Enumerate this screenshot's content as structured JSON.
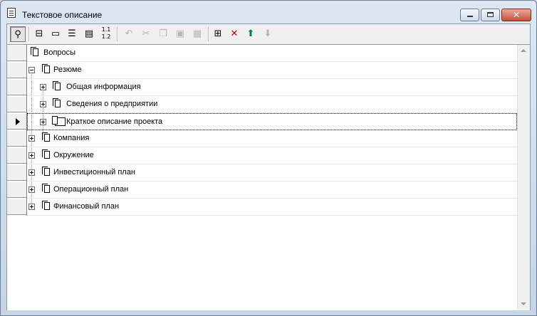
{
  "window": {
    "title": "Текстовое описание"
  },
  "toolbar": {
    "buttons": [
      {
        "name": "search-tool-icon",
        "glyph": "🔍"
      },
      {
        "name": "tree-structure-icon",
        "glyph": "⊞"
      },
      {
        "name": "comment-icon",
        "glyph": "💬"
      },
      {
        "name": "list-view-icon",
        "glyph": "≣"
      },
      {
        "name": "highlight-mark-icon",
        "glyph": "▤"
      },
      {
        "name": "numbering-icon",
        "glyph": "1.1"
      },
      {
        "name": "undo-icon",
        "glyph": "↶"
      },
      {
        "name": "cut-icon",
        "glyph": "✂"
      },
      {
        "name": "copy-icon",
        "glyph": "⧉"
      },
      {
        "name": "paste-icon",
        "glyph": "📋"
      },
      {
        "name": "paste-special-icon",
        "glyph": "▦"
      },
      {
        "name": "insert-node-icon",
        "glyph": "⊞"
      },
      {
        "name": "delete-icon",
        "glyph": "✕"
      },
      {
        "name": "move-up-icon",
        "glyph": "⬆"
      },
      {
        "name": "move-down-icon",
        "glyph": "⬇"
      }
    ]
  },
  "tree": {
    "rows": [
      {
        "label": "Вопросы"
      },
      {
        "label": "Резюме"
      },
      {
        "label": "Общая информация"
      },
      {
        "label": "Сведения о предприятии"
      },
      {
        "label": "Краткое описание проекта"
      },
      {
        "label": "Компания"
      },
      {
        "label": "Окружение"
      },
      {
        "label": "Инвестиционный план"
      },
      {
        "label": "Операционный план"
      },
      {
        "label": "Финансовый план"
      }
    ]
  },
  "colors": {
    "delete": "#c00000",
    "move_up": "#0a7a5a",
    "disabled": "#b5b5b5"
  }
}
